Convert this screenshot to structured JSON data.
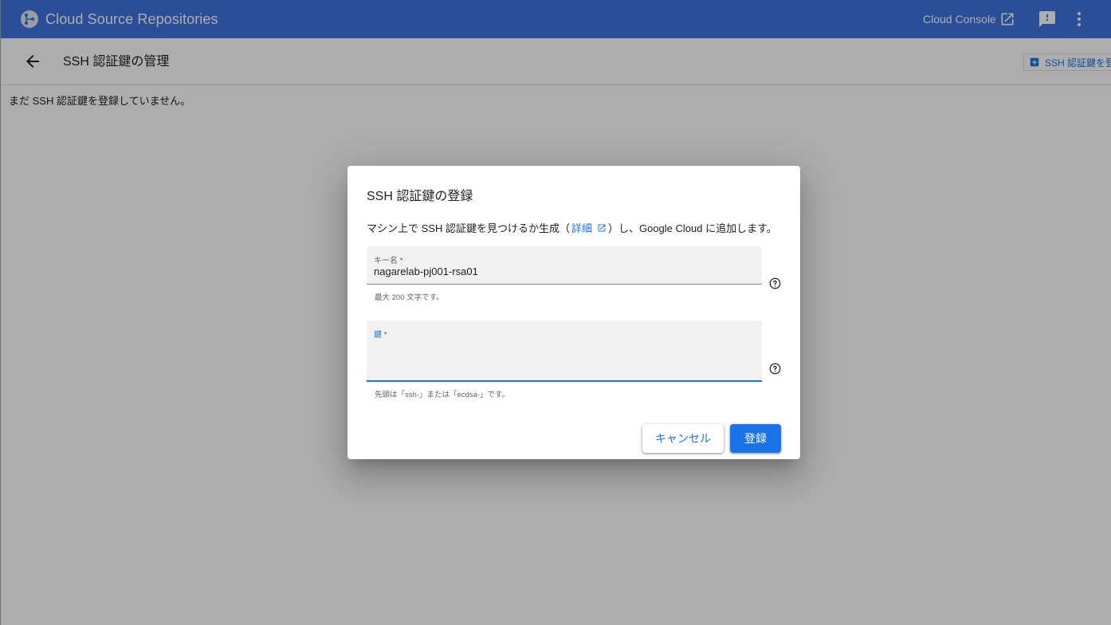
{
  "appbar": {
    "title": "Cloud Source Repositories",
    "console_link": "Cloud Console",
    "icons": [
      "repositories-logo-icon",
      "open-in-new-icon",
      "feedback-icon",
      "more-vert-icon"
    ]
  },
  "subheader": {
    "title": "SSH 認証鍵の管理",
    "register_button": "SSH 認証鍵を登録",
    "icons": [
      "arrow-back-icon",
      "add-box-icon"
    ]
  },
  "main": {
    "empty_message": "まだ SSH 認証鍵を登録していません。"
  },
  "dialog": {
    "title": "SSH 認証鍵の登録",
    "description_prefix": "マシン上で SSH 認証鍵を見つけるか生成（",
    "description_link": "詳細",
    "description_suffix": "）し、Google Cloud に追加します。",
    "key_name": {
      "label": "キー名 *",
      "value": "nagarelab-pj001-rsa01",
      "hint": "最大 200 文字です。"
    },
    "key": {
      "label": "鍵 *",
      "value": "",
      "hint": "先頭は「ssh-」または「ecdsa-」です。"
    },
    "cancel_label": "キャンセル",
    "submit_label": "登録"
  },
  "colors": {
    "appbar": "#3f74e0",
    "accent": "#1a73e8",
    "scrim": "rgba(0,0,0,0.32)"
  }
}
